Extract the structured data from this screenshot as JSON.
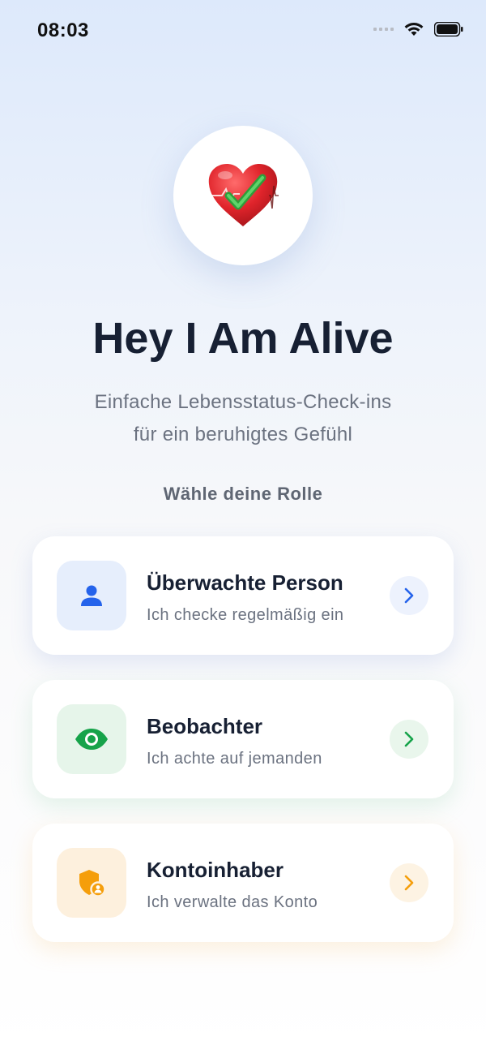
{
  "status_bar": {
    "time": "08:03"
  },
  "app": {
    "title": "Hey I Am Alive",
    "subtitle_line1": "Einfache Lebensstatus-Check-ins",
    "subtitle_line2": "für ein beruhigtes Gefühl",
    "logo_icon": "heart-check-icon"
  },
  "role_section": {
    "label": "Wähle deine Rolle"
  },
  "roles": [
    {
      "title": "Überwachte Person",
      "subtitle": "Ich checke regelmäßig ein",
      "icon": "person-icon",
      "accent": "#2563eb"
    },
    {
      "title": "Beobachter",
      "subtitle": "Ich achte auf jemanden",
      "icon": "eye-icon",
      "accent": "#16a34a"
    },
    {
      "title": "Kontoinhaber",
      "subtitle": "Ich verwalte das Konto",
      "icon": "shield-user-icon",
      "accent": "#f59e0b"
    }
  ]
}
